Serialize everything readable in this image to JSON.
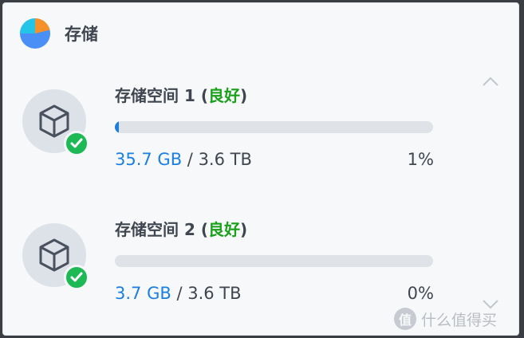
{
  "header": {
    "title": "存储",
    "icon": "pie-chart-icon"
  },
  "volumes": [
    {
      "name": "存储空间 1",
      "status_open": "(",
      "status": "良好",
      "status_close": ")",
      "used": "35.7 GB",
      "separator": " / ",
      "total": "3.6 TB",
      "percent_label": "1%",
      "fill_fraction": 0.012
    },
    {
      "name": "存储空间 2",
      "status_open": "(",
      "status": "良好",
      "status_close": ")",
      "used": "3.7 GB",
      "separator": " / ",
      "total": "3.6 TB",
      "percent_label": "0%",
      "fill_fraction": 0.0
    }
  ],
  "watermark": {
    "badge": "值",
    "text": "什么值得买"
  },
  "colors": {
    "accent": "#1a7fe0",
    "good": "#1aa01a",
    "badge": "#1db954",
    "pie_blue": "#4a8ff5",
    "pie_orange": "#f5902a",
    "pie_cyan": "#22c4e8"
  }
}
